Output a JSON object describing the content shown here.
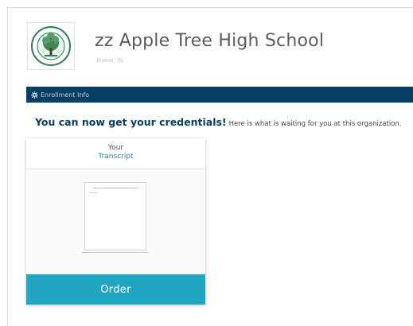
{
  "organization": {
    "name": "zz Apple Tree High School",
    "location": "Blaine, IN"
  },
  "nav": {
    "enrollment_label": "Enrollment Info"
  },
  "headline": {
    "strong": "You can now get your credentials!",
    "rest": "Here is what is waiting for you at this organization."
  },
  "card": {
    "title_line1": "Your",
    "title_line2": "Transcript",
    "order_label": "Order"
  },
  "colors": {
    "nav_bar": "#063e63",
    "order_button": "#22a7c3",
    "headline": "#063e63",
    "logo_green": "#2e7d4f"
  }
}
